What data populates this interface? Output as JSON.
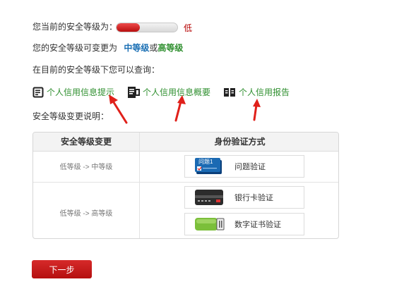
{
  "security": {
    "current_label": "您当前的安全等级为：",
    "level_value": "低",
    "meter_fraction": 0.38,
    "meter_color": "#c41616",
    "change_prefix": "您的安全等级可变更为",
    "change_mid": "中等级",
    "change_or": "或",
    "change_high": "高等级",
    "query_label": "在目前的安全等级下您可以查询："
  },
  "queries": [
    {
      "label": "个人信用信息提示",
      "icon": "document-lines-icon"
    },
    {
      "label": "个人信用信息概要",
      "icon": "document-summary-icon"
    },
    {
      "label": "个人信用报告",
      "icon": "open-book-icon"
    }
  ],
  "explain_label": "安全等级变更说明：",
  "table": {
    "headers": [
      "安全等级变更",
      "身份验证方式"
    ],
    "rows": [
      {
        "change": "低等级 -> 中等级",
        "methods": [
          {
            "label": "问题验证",
            "icon": "question-card-icon",
            "icon_text": "问题1"
          }
        ]
      },
      {
        "change": "低等级 -> 高等级",
        "methods": [
          {
            "label": "银行卡验证",
            "icon": "bank-card-icon"
          },
          {
            "label": "数字证书验证",
            "icon": "usb-key-icon"
          }
        ]
      }
    ]
  },
  "next_button": "下一步",
  "colors": {
    "accent_red": "#c41616",
    "link_green": "#2f8f2f",
    "link_blue": "#1a6fb4"
  }
}
